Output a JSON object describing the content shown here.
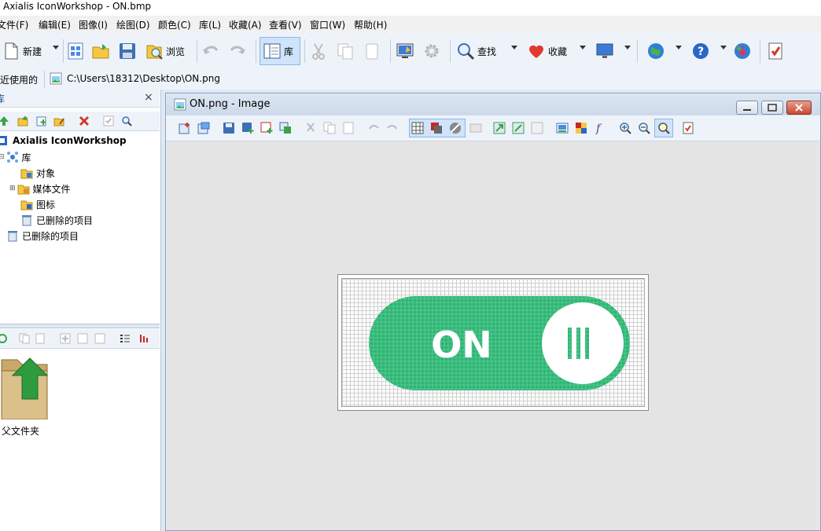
{
  "app": {
    "title": "Axialis IconWorkshop - ON.bmp"
  },
  "menu": [
    "文件(F)",
    "编辑(E)",
    "图像(I)",
    "绘图(D)",
    "颜色(C)",
    "库(L)",
    "收藏(A)",
    "查看(V)",
    "窗口(W)",
    "帮助(H)"
  ],
  "toolbar": {
    "new_label": "新建",
    "browse_label": "浏览",
    "library_label": "库",
    "find_label": "查找",
    "favorites_label": "收藏"
  },
  "pathbar": {
    "recent_label": "最近使用的",
    "path": "C:\\Users\\18312\\Desktop\\ON.png"
  },
  "left_panel": {
    "header_label": "库",
    "close_glyph": "×",
    "tree": {
      "root": "Axialis IconWorkshop",
      "library": "库",
      "objects": "对象",
      "media_files": "媒体文件",
      "icons": "图标",
      "deleted_items_child": "已删除的项目",
      "deleted_items": "已删除的项目"
    },
    "browser": {
      "parent_folder": "父文件夹"
    }
  },
  "document": {
    "title": "ON.png - Image",
    "image_text": "ON"
  },
  "colors": {
    "switch_green": "#2bb673",
    "toolbar_bg": "#eef3fa",
    "active_btn": "#cfe3fb",
    "heart_red": "#e2392c",
    "help_blue": "#2a66c8"
  }
}
